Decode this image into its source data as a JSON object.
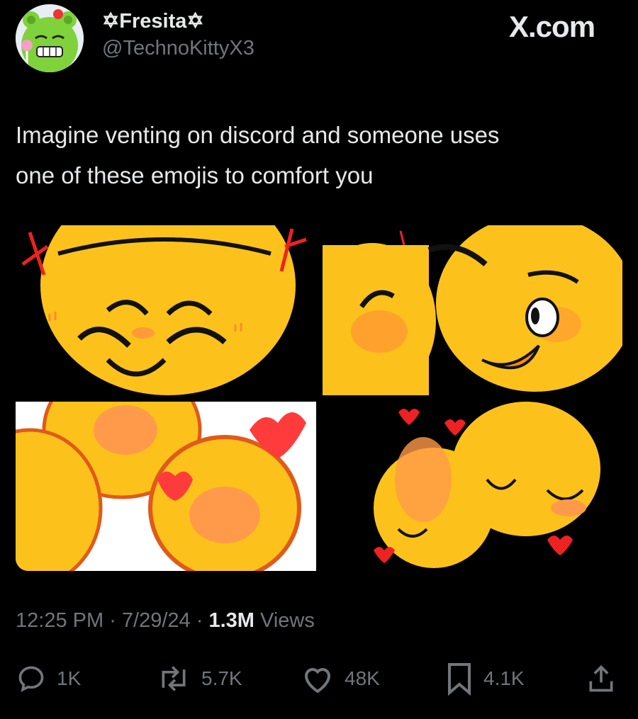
{
  "header": {
    "display_name": "✡Fresita✡",
    "handle": "@TechnoKittyX3",
    "brand": "X.com"
  },
  "tweet": {
    "line1": "Imagine venting on discord and someone uses",
    "line2": "one of these emojis to comfort you"
  },
  "meta": {
    "time": "12:25 PM",
    "sep1": " · ",
    "date": "7/29/24",
    "sep2": " · ",
    "views_count": "1.3M",
    "views_label": " Views"
  },
  "actions": {
    "replies": "1K",
    "reposts": "5.7K",
    "likes": "48K",
    "bookmarks": "4.1K"
  },
  "icons": [
    "avatar-image",
    "reply-icon",
    "repost-icon",
    "like-icon",
    "bookmark-icon",
    "share-icon"
  ],
  "colors": {
    "background": "#000000",
    "text": "#e7e9ea",
    "muted": "#71767b",
    "emoji_yellow": "#fcc21b",
    "blush": "#ff8c3a"
  }
}
